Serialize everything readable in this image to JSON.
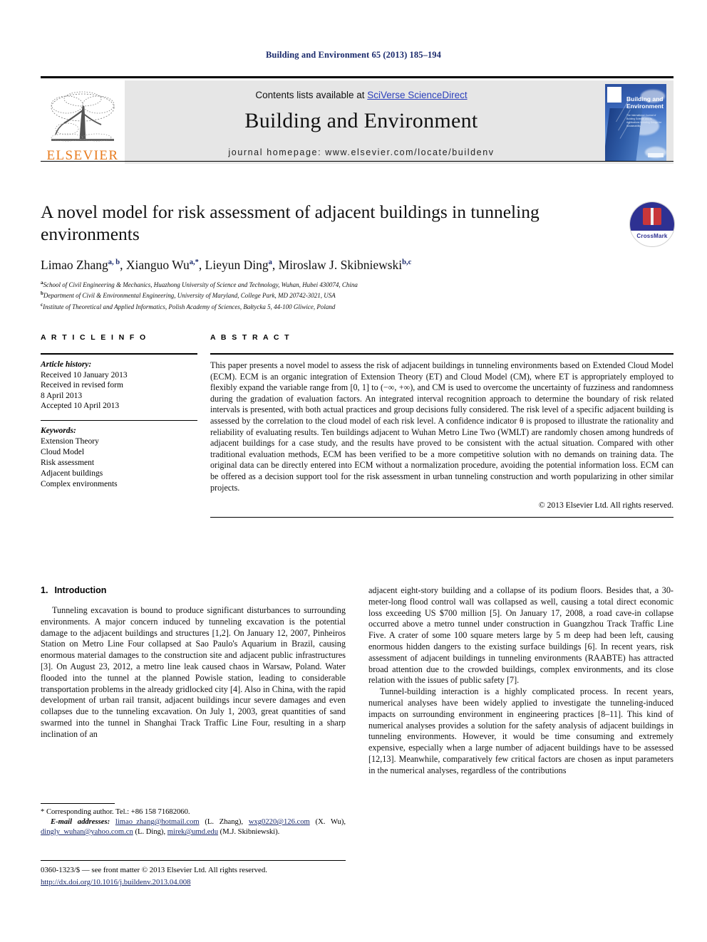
{
  "running_head": "Building and Environment 65 (2013) 185–194",
  "masthead": {
    "contents_prefix": "Contents lists available at ",
    "sciverse_link": "SciVerse ScienceDirect",
    "journal_title": "Building and Environment",
    "homepage": "journal homepage: www.elsevier.com/locate/buildenv",
    "publisher_wordmark": "ELSEVIER",
    "cover": {
      "title_line1": "Building and",
      "title_line2": "Environment",
      "subtitle": "The International Journal of Building Science and its Applications Including Design for Sustainability"
    }
  },
  "crossmark": {
    "label": "CrossMark"
  },
  "article": {
    "title": "A novel model for risk assessment of adjacent buildings in tunneling environments",
    "authors": [
      {
        "name": "Limao Zhang",
        "sup": "a, b",
        "sep": ", "
      },
      {
        "name": "Xianguo Wu",
        "sup": "a,*",
        "sep": ", "
      },
      {
        "name": "Lieyun Ding",
        "sup": "a",
        "sep": ", "
      },
      {
        "name": "Miroslaw J. Skibniewski",
        "sup": "b,c",
        "sep": ""
      }
    ],
    "affiliations": [
      {
        "mark": "a",
        "text": "School of Civil Engineering & Mechanics, Huazhong University of Science and Technology, Wuhan, Hubei 430074, China"
      },
      {
        "mark": "b",
        "text": "Department of Civil & Environmental Engineering, University of Maryland, College Park, MD 20742-3021, USA"
      },
      {
        "mark": "c",
        "text": "Institute of Theoretical and Applied Informatics, Polish Academy of Sciences, Bałtycka 5, 44-100 Gliwice, Poland"
      }
    ]
  },
  "article_info": {
    "heading": "A R T I C L E  I N F O",
    "history_label": "Article history:",
    "history": [
      "Received 10 January 2013",
      "Received in revised form",
      "8 April 2013",
      "Accepted 10 April 2013"
    ],
    "keywords_label": "Keywords:",
    "keywords": [
      "Extension Theory",
      "Cloud Model",
      "Risk assessment",
      "Adjacent buildings",
      "Complex environments"
    ]
  },
  "abstract": {
    "heading": "A B S T R A C T",
    "text": "This paper presents a novel model to assess the risk of adjacent buildings in tunneling environments based on Extended Cloud Model (ECM). ECM is an organic integration of Extension Theory (ET) and Cloud Model (CM), where ET is appropriately employed to flexibly expand the variable range from [0, 1] to (−∞, +∞), and CM is used to overcome the uncertainty of fuzziness and randomness during the gradation of evaluation factors. An integrated interval recognition approach to determine the boundary of risk related intervals is presented, with both actual practices and group decisions fully considered. The risk level of a specific adjacent building is assessed by the correlation to the cloud model of each risk level. A confidence indicator θ is proposed to illustrate the rationality and reliability of evaluating results. Ten buildings adjacent to Wuhan Metro Line Two (WMLT) are randomly chosen among hundreds of adjacent buildings for a case study, and the results have proved to be consistent with the actual situation. Compared with other traditional evaluation methods, ECM has been verified to be a more competitive solution with no demands on training data. The original data can be directly entered into ECM without a normalization procedure, avoiding the potential information loss. ECM can be offered as a decision support tool for the risk assessment in urban tunneling construction and worth popularizing in other similar projects.",
    "copyright": "© 2013 Elsevier Ltd. All rights reserved."
  },
  "introduction": {
    "number": "1.",
    "heading": "Introduction",
    "left_paragraphs": [
      "Tunneling excavation is bound to produce significant disturbances to surrounding environments. A major concern induced by tunneling excavation is the potential damage to the adjacent buildings and structures [1,2]. On January 12, 2007, Pinheiros Station on Metro Line Four collapsed at Sao Paulo's Aquarium in Brazil, causing enormous material damages to the construction site and adjacent public infrastructures [3]. On August 23, 2012, a metro line leak caused chaos in Warsaw, Poland. Water flooded into the tunnel at the planned Powisle station, leading to considerable transportation problems in the already gridlocked city [4]. Also in China, with the rapid development of urban rail transit, adjacent buildings incur severe damages and even collapses due to the tunneling excavation. On July 1, 2003, great quantities of sand swarmed into the tunnel in Shanghai Track Traffic Line Four, resulting in a sharp inclination of an"
    ],
    "right_paragraphs": [
      "adjacent eight-story building and a collapse of its podium floors. Besides that, a 30-meter-long flood control wall was collapsed as well, causing a total direct economic loss exceeding US $700 million [5]. On January 17, 2008, a road cave-in collapse occurred above a metro tunnel under construction in Guangzhou Track Traffic Line Five. A crater of some 100 square meters large by 5 m deep had been left, causing enormous hidden dangers to the existing surface buildings [6]. In recent years, risk assessment of adjacent buildings in tunneling environments (RAABTE) has attracted broad attention due to the crowded buildings, complex environments, and its close relation with the issues of public safety [7].",
      "Tunnel-building interaction is a highly complicated process. In recent years, numerical analyses have been widely applied to investigate the tunneling-induced impacts on surrounding environment in engineering practices [8–11]. This kind of numerical analyses provides a solution for the safety analysis of adjacent buildings in tunneling environments. However, it would be time consuming and extremely expensive, especially when a large number of adjacent buildings have to be assessed [12,13]. Meanwhile, comparatively few critical factors are chosen as input parameters in the numerical analyses, regardless of the contributions"
    ]
  },
  "footnote": {
    "corresponding": "* Corresponding author. Tel.: +86 158 71682060.",
    "email_label": "E-mail addresses:",
    "emails": [
      {
        "address": "limao_zhang@hotmail.com",
        "owner": "(L. Zhang)"
      },
      {
        "address": "wxg0220@126.com",
        "owner": "(X. Wu)"
      },
      {
        "address": "dingly_wuhan@yahoo.com.cn",
        "owner": "(L. Ding)"
      },
      {
        "address": "mirek@umd.edu",
        "owner": "(M.J. Skibniewski)"
      }
    ]
  },
  "footer": {
    "line1": "0360-1323/$ — see front matter © 2013 Elsevier Ltd. All rights reserved.",
    "doi": "http://dx.doi.org/10.1016/j.buildenv.2013.04.008"
  }
}
